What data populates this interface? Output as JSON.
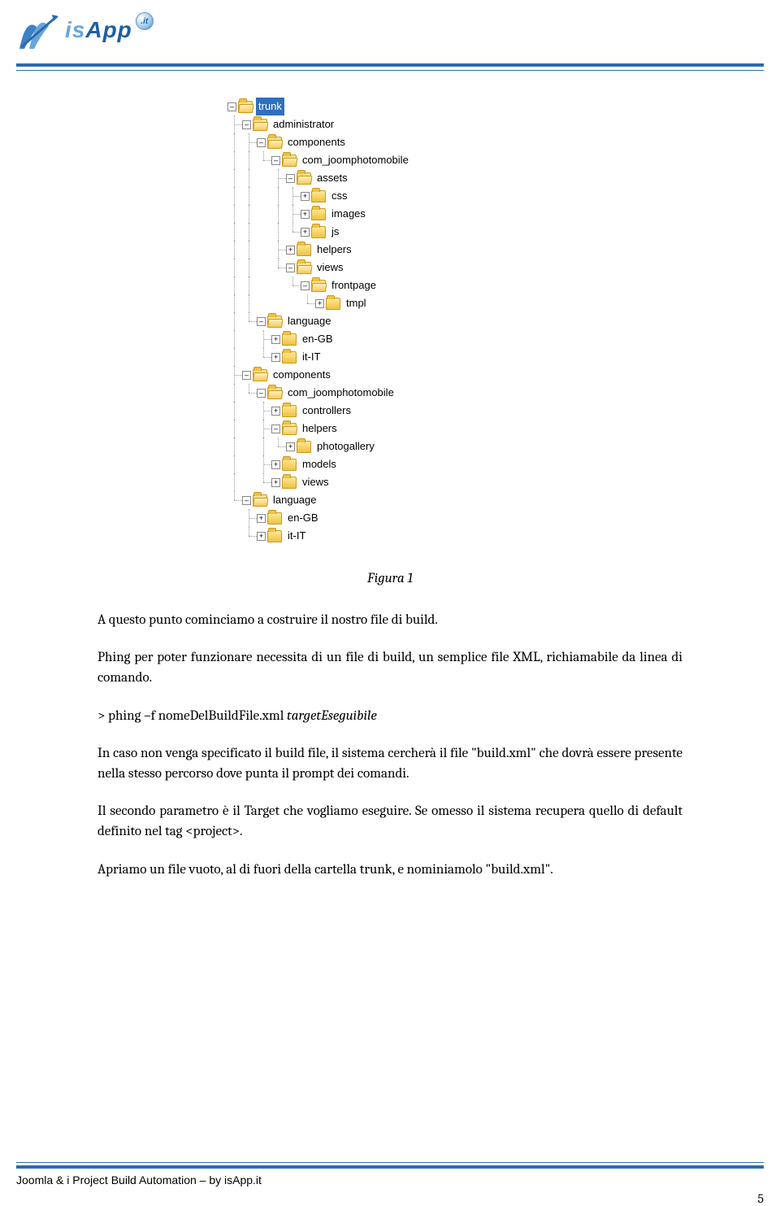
{
  "header": {
    "logo_is": "is",
    "logo_app": "App",
    "badge": ".it"
  },
  "tree": {
    "rows": [
      {
        "depth": 0,
        "conns": [],
        "pm": "-",
        "open": true,
        "label": "trunk",
        "selected": true
      },
      {
        "depth": 1,
        "conns": [
          "tee"
        ],
        "pm": "-",
        "open": true,
        "label": "administrator"
      },
      {
        "depth": 2,
        "conns": [
          "vline",
          "tee"
        ],
        "pm": "-",
        "open": true,
        "label": "components"
      },
      {
        "depth": 3,
        "conns": [
          "vline",
          "vline",
          "elbow"
        ],
        "pm": "-",
        "open": true,
        "label": "com_joomphotomobile"
      },
      {
        "depth": 4,
        "conns": [
          "vline",
          "vline",
          "blank",
          "tee"
        ],
        "pm": "-",
        "open": true,
        "label": "assets"
      },
      {
        "depth": 5,
        "conns": [
          "vline",
          "vline",
          "blank",
          "vline",
          "tee"
        ],
        "pm": "+",
        "open": false,
        "label": "css"
      },
      {
        "depth": 5,
        "conns": [
          "vline",
          "vline",
          "blank",
          "vline",
          "tee"
        ],
        "pm": "+",
        "open": false,
        "label": "images"
      },
      {
        "depth": 5,
        "conns": [
          "vline",
          "vline",
          "blank",
          "vline",
          "elbow"
        ],
        "pm": "+",
        "open": false,
        "label": "js"
      },
      {
        "depth": 4,
        "conns": [
          "vline",
          "vline",
          "blank",
          "tee"
        ],
        "pm": "+",
        "open": false,
        "label": "helpers"
      },
      {
        "depth": 4,
        "conns": [
          "vline",
          "vline",
          "blank",
          "elbow"
        ],
        "pm": "-",
        "open": true,
        "label": "views"
      },
      {
        "depth": 5,
        "conns": [
          "vline",
          "vline",
          "blank",
          "blank",
          "elbow"
        ],
        "pm": "-",
        "open": true,
        "label": "frontpage"
      },
      {
        "depth": 6,
        "conns": [
          "vline",
          "vline",
          "blank",
          "blank",
          "blank",
          "elbow"
        ],
        "pm": "+",
        "open": false,
        "label": "tmpl"
      },
      {
        "depth": 2,
        "conns": [
          "vline",
          "elbow"
        ],
        "pm": "-",
        "open": true,
        "label": "language"
      },
      {
        "depth": 3,
        "conns": [
          "vline",
          "blank",
          "tee"
        ],
        "pm": "+",
        "open": false,
        "label": "en-GB"
      },
      {
        "depth": 3,
        "conns": [
          "vline",
          "blank",
          "elbow"
        ],
        "pm": "+",
        "open": false,
        "label": "it-IT"
      },
      {
        "depth": 1,
        "conns": [
          "tee"
        ],
        "pm": "-",
        "open": true,
        "label": "components"
      },
      {
        "depth": 2,
        "conns": [
          "vline",
          "elbow"
        ],
        "pm": "-",
        "open": true,
        "label": "com_joomphotomobile"
      },
      {
        "depth": 3,
        "conns": [
          "vline",
          "blank",
          "tee"
        ],
        "pm": "+",
        "open": false,
        "label": "controllers"
      },
      {
        "depth": 3,
        "conns": [
          "vline",
          "blank",
          "tee"
        ],
        "pm": "-",
        "open": true,
        "label": "helpers"
      },
      {
        "depth": 4,
        "conns": [
          "vline",
          "blank",
          "vline",
          "elbow"
        ],
        "pm": "+",
        "open": false,
        "label": "photogallery"
      },
      {
        "depth": 3,
        "conns": [
          "vline",
          "blank",
          "tee"
        ],
        "pm": "+",
        "open": false,
        "label": "models"
      },
      {
        "depth": 3,
        "conns": [
          "vline",
          "blank",
          "elbow"
        ],
        "pm": "+",
        "open": false,
        "label": "views"
      },
      {
        "depth": 1,
        "conns": [
          "elbow"
        ],
        "pm": "-",
        "open": true,
        "label": "language"
      },
      {
        "depth": 2,
        "conns": [
          "blank",
          "tee"
        ],
        "pm": "+",
        "open": false,
        "label": "en-GB"
      },
      {
        "depth": 2,
        "conns": [
          "blank",
          "elbow"
        ],
        "pm": "+",
        "open": false,
        "label": "it-IT"
      }
    ]
  },
  "caption": "Figura 1",
  "paragraphs": {
    "p1": "A questo punto cominciamo a costruire il nostro file di build.",
    "p2": "Phing per poter funzionare necessita di un file di build, un semplice file XML, richiamabile da linea di comando.",
    "cmd_prefix": "> phing –f nomeDelBuildFile.xml ",
    "cmd_suffix": "targetEseguibile",
    "p3": "In caso non venga specificato il build file, il sistema cercherà il file \"build.xml\" che dovrà essere presente nella stesso percorso dove punta il prompt dei comandi.",
    "p4": "Il secondo parametro è il Target che vogliamo eseguire. Se omesso il sistema recupera quello di default definito nel tag <project>.",
    "p5": "Apriamo un file vuoto, al di fuori della cartella trunk, e nominiamolo \"build.xml\"."
  },
  "footer": {
    "left": "Joomla & i Project Build Automation – by isApp.it",
    "page": "5"
  }
}
